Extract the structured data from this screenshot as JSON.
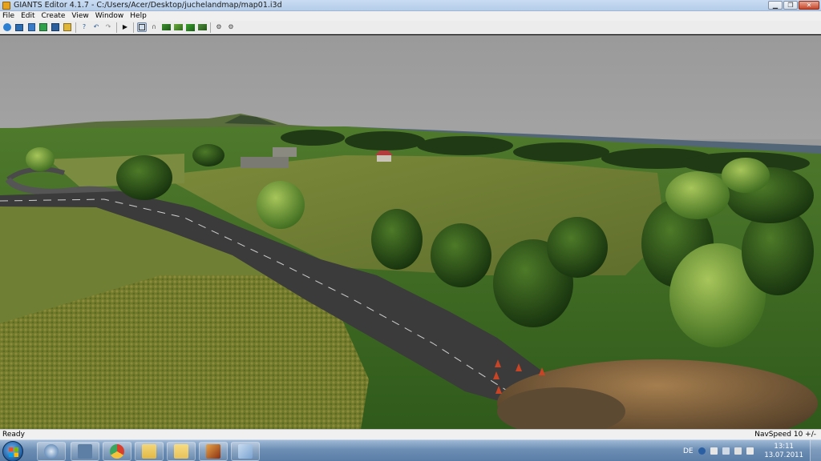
{
  "window": {
    "title": "GIANTS Editor 4.1.7 - C:/Users/Acer/Desktop/juchelandmap/map01.i3d",
    "icon": "giants-app-icon",
    "controls": [
      "minimize-icon",
      "restore-icon",
      "close-icon"
    ]
  },
  "menu": {
    "items": [
      {
        "label": "File"
      },
      {
        "label": "Edit"
      },
      {
        "label": "Create"
      },
      {
        "label": "View"
      },
      {
        "label": "Window"
      },
      {
        "label": "Help"
      }
    ]
  },
  "toolbar": {
    "buttons": [
      "new-file-icon",
      "open-file-icon",
      "save-icon",
      "export-icon",
      "save-as-icon",
      "import-icon",
      "separator",
      "help-icon",
      "undo-icon",
      "redo-icon",
      "separator",
      "play-icon",
      "separator",
      "select-tool-icon",
      "move-tool-icon",
      "terrain-sculpt-icon",
      "terrain-paint-icon",
      "foliage-paint-icon",
      "terrain-detail-icon",
      "separator",
      "settings-gear-icon",
      "settings-gear-alt-icon"
    ],
    "selected": "select-tool-icon"
  },
  "viewport": {
    "scene": "3D terrain view: fields, road, trees, traffic cones"
  },
  "status": {
    "left": "Ready",
    "navspeed": "NavSpeed 10 +/-"
  },
  "taskbar": {
    "start": "windows-start-icon",
    "apps": [
      {
        "name": "giants-editor-taskbar-icon",
        "color": "#3b6fa8"
      },
      {
        "name": "calculator-taskbar-icon",
        "color": "#5d7fa6"
      },
      {
        "name": "chrome-taskbar-icon",
        "color": "#d8402e"
      },
      {
        "name": "explorer-taskbar-icon",
        "color": "#e2b845"
      },
      {
        "name": "folder-taskbar-icon",
        "color": "#e8c25a"
      },
      {
        "name": "app-taskbar-icon",
        "color": "#c45a22"
      },
      {
        "name": "paint-taskbar-icon",
        "color": "#7aa3d1"
      }
    ],
    "tray": {
      "language": "DE",
      "icons": [
        "network-tray-icon",
        "flag-tray-icon",
        "action-center-icon",
        "wifi-icon",
        "volume-icon",
        "signal-icon"
      ],
      "time": "13:11",
      "date": "13.07.2011"
    }
  }
}
